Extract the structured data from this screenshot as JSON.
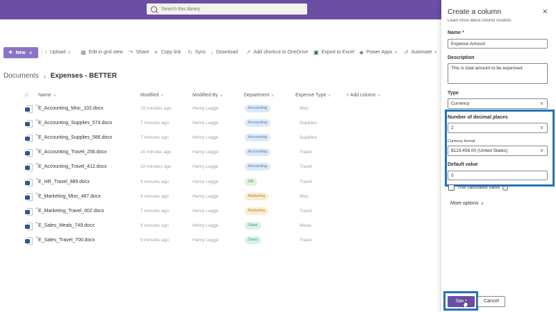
{
  "search": {
    "placeholder": "Search this library"
  },
  "commands": {
    "new": "New",
    "upload": "Upload",
    "edit_grid": "Edit in grid view",
    "share": "Share",
    "copy_link": "Copy link",
    "sync": "Sync",
    "download": "Download",
    "add_shortcut": "Add shortcut to OneDrive",
    "export_excel": "Export to Excel",
    "power_apps": "Power Apps",
    "automate": "Automate"
  },
  "breadcrumb": {
    "root": "Documents",
    "current": "Expenses - BETTER"
  },
  "columns": {
    "name": "Name",
    "modified": "Modified",
    "modified_by": "Modified By",
    "department": "Department",
    "expense_type": "Expense Type",
    "add_column": "+ Add column"
  },
  "rows": [
    {
      "name": "E_Accounting_Misc_102.docx",
      "modified": "10 minutes ago",
      "by": "Henry Legge",
      "dept": "Accounting",
      "type": "Misc"
    },
    {
      "name": "E_Accounting_Supplies_574.docx",
      "modified": "7 minutes ago",
      "by": "Henry Legge",
      "dept": "Accounting",
      "type": "Supplies"
    },
    {
      "name": "E_Accounting_Supplies_586.docx",
      "modified": "7 minutes ago",
      "by": "Henry Legge",
      "dept": "Accounting",
      "type": "Supplies"
    },
    {
      "name": "E_Accounting_Travel_256.docx",
      "modified": "10 minutes ago",
      "by": "Henry Legge",
      "dept": "Accounting",
      "type": "Travel"
    },
    {
      "name": "E_Accounting_Travel_412.docx",
      "modified": "10 minutes ago",
      "by": "Henry Legge",
      "dept": "Accounting",
      "type": "Travel"
    },
    {
      "name": "E_HR_Travel_989.docx",
      "modified": "9 minutes ago",
      "by": "Henry Legge",
      "dept": "HR",
      "type": "Travel"
    },
    {
      "name": "E_Marketing_Misc_487.docx",
      "modified": "9 minutes ago",
      "by": "Henry Legge",
      "dept": "Marketing",
      "type": "Misc"
    },
    {
      "name": "E_Marketing_Travel_002.docx",
      "modified": "7 minutes ago",
      "by": "Henry Legge",
      "dept": "Marketing",
      "type": "Travel"
    },
    {
      "name": "E_Sales_Meals_749.docx",
      "modified": "9 minutes ago",
      "by": "Henry Legge",
      "dept": "Sales",
      "type": "Meals"
    },
    {
      "name": "E_Sales_Travel_700.docx",
      "modified": "9 minutes ago",
      "by": "Henry Legge",
      "dept": "Sales",
      "type": "Travel"
    }
  ],
  "panel": {
    "title": "Create a column",
    "learn_more": "Learn more about column creation.",
    "name_label": "Name",
    "name_value": "Expense Amount",
    "description_label": "Description",
    "description_value": "This is total amount to be expensed",
    "type_label": "Type",
    "type_value": "Currency",
    "decimals_label": "Number of decimal places",
    "decimals_value": "2",
    "currency_format_label": "Currency format",
    "currency_format_value": "$123,456.00 (United States)",
    "default_label": "Default value",
    "default_value": "0",
    "calculated_label": "Use calculated value",
    "more_options": "More options",
    "save": "Save",
    "cancel": "Cancel"
  },
  "colors": {
    "suite_bar": "#6a4fa3",
    "new_button": "#8b74c3",
    "highlight": "#2372b8"
  }
}
